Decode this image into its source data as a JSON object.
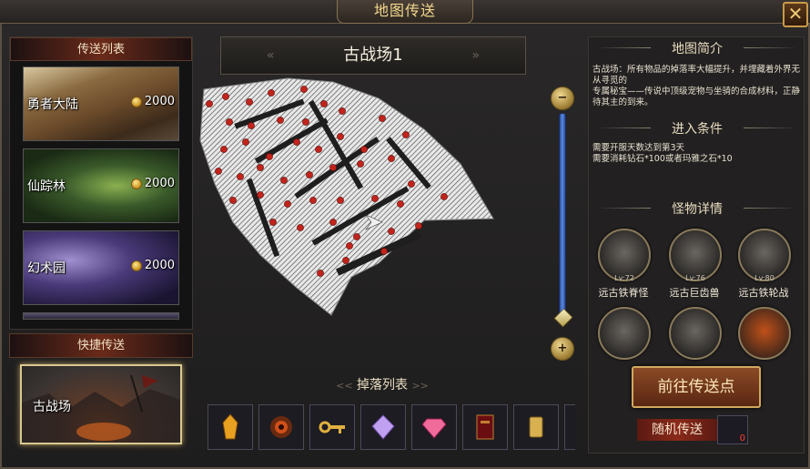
{
  "window": {
    "title": "地图传送",
    "close_label": "✕"
  },
  "teleport_list": {
    "header": "传送列表",
    "items": [
      {
        "name": "勇者大陆",
        "cost": "2000"
      },
      {
        "name": "仙踪林",
        "cost": "2000"
      },
      {
        "name": "幻术园",
        "cost": "2000"
      }
    ]
  },
  "quick_teleport": {
    "header": "快捷传送",
    "item": {
      "name": "古战场"
    }
  },
  "map": {
    "name": "古战场1",
    "prev_arrow": "«",
    "next_arrow": "»"
  },
  "zoom": {
    "out_label": "−",
    "in_label": "+",
    "level": 0.05
  },
  "drops": {
    "title": "掉落列表",
    "items": [
      "amber-crystal",
      "red-eye-orb",
      "golden-key",
      "purple-diamond",
      "pink-gem",
      "red-book",
      "gold-tablet"
    ]
  },
  "info": {
    "intro_title": "地图简介",
    "intro_text_1": "古战场：所有物品的掉落率大幅提升，并埋藏着外界无从寻觅的",
    "intro_text_2": "专属秘宝——传说中顶级宠物与坐骑的合成材料，正静待其主的到来。",
    "cond_title": "进入条件",
    "cond_1": "需要开服天数达到第3天",
    "cond_2": "需要消耗钻石*100或者玛雅之石*10",
    "monster_title": "怪物详情",
    "monsters": [
      {
        "level": "Lv:72",
        "name": "远古铁脊怪"
      },
      {
        "level": "Lv:76",
        "name": "远古巨齿兽"
      },
      {
        "level": "Lv:80",
        "name": "远古铁轮战"
      },
      {
        "level": "",
        "name": ""
      },
      {
        "level": "",
        "name": ""
      },
      {
        "level": "",
        "name": ""
      }
    ]
  },
  "actions": {
    "go_label": "前往传送点",
    "random_label": "随机传送",
    "random_count": "0"
  },
  "colors": {
    "accent": "#f3d68c",
    "enemy_dot": "#c0241c",
    "panel_red": "#6a2a1a"
  }
}
